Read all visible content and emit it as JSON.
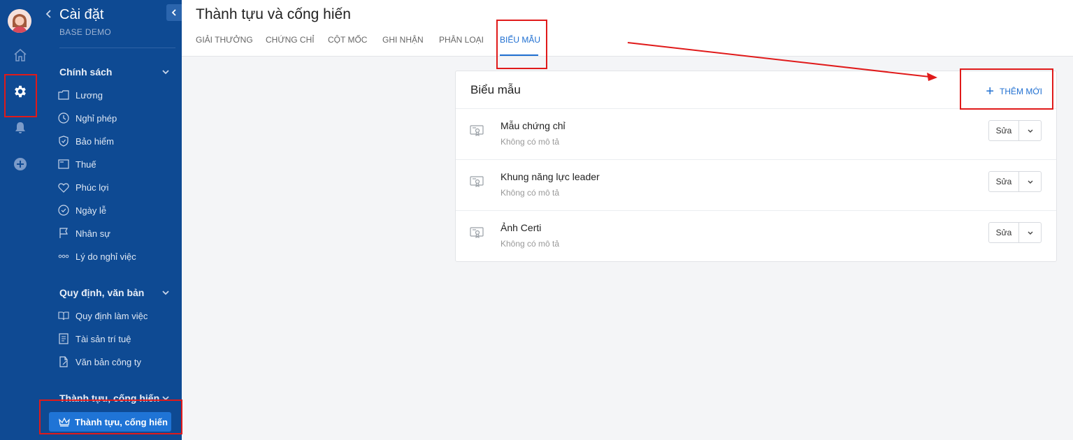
{
  "header": {
    "title": "Thành tựu và cống hiến",
    "tabs": [
      "GIẢI THƯỞNG",
      "CHỨNG CHỈ",
      "CỘT MỐC",
      "GHI NHẬN",
      "PHÂN LOẠI",
      "BIỂU MẪU"
    ],
    "active_tab": "BIỂU MẪU"
  },
  "rail": {
    "icons": [
      "avatar",
      "home-icon",
      "gear-icon",
      "bell-icon",
      "plus-circle-icon"
    ]
  },
  "sidebar": {
    "title": "Cài đặt",
    "subtitle": "BASE DEMO",
    "sections": [
      {
        "heading": "Chính sách",
        "items": [
          {
            "label": "Lương",
            "icon": "folder-icon"
          },
          {
            "label": "Nghỉ phép",
            "icon": "clock-icon"
          },
          {
            "label": "Bảo hiểm",
            "icon": "shield-icon"
          },
          {
            "label": "Thuế",
            "icon": "document-icon"
          },
          {
            "label": "Phúc lợi",
            "icon": "heart-icon"
          },
          {
            "label": "Ngày lễ",
            "icon": "check-circle-icon"
          },
          {
            "label": "Nhân sự",
            "icon": "flag-icon"
          },
          {
            "label": "Lý do nghỉ việc",
            "icon": "dots-icon"
          }
        ]
      },
      {
        "heading": "Quy định, văn bản",
        "items": [
          {
            "label": "Quy định làm việc",
            "icon": "book-icon"
          },
          {
            "label": "Tài sản trí tuệ",
            "icon": "list-icon"
          },
          {
            "label": "Văn bản công ty",
            "icon": "file-edit-icon"
          }
        ]
      },
      {
        "heading": "Thành tựu, cống hiến",
        "items": [
          {
            "label": "Thành tựu, cống hiến",
            "icon": "crown-icon",
            "active": true
          }
        ]
      }
    ]
  },
  "card": {
    "title": "Biểu mẫu",
    "add_label": "THÊM MỚI",
    "rows": [
      {
        "name": "Mẫu chứng chỉ",
        "desc": "Không có mô tả",
        "edit_label": "Sửa"
      },
      {
        "name": "Khung năng lực leader",
        "desc": "Không có mô tả",
        "edit_label": "Sửa"
      },
      {
        "name": "Ảnh Certi",
        "desc": "Không có mô tả",
        "edit_label": "Sửa"
      }
    ]
  },
  "colors": {
    "sidebar_bg": "#0e4a93",
    "accent": "#1f6fd1",
    "annotation_red": "#e01a1a"
  }
}
